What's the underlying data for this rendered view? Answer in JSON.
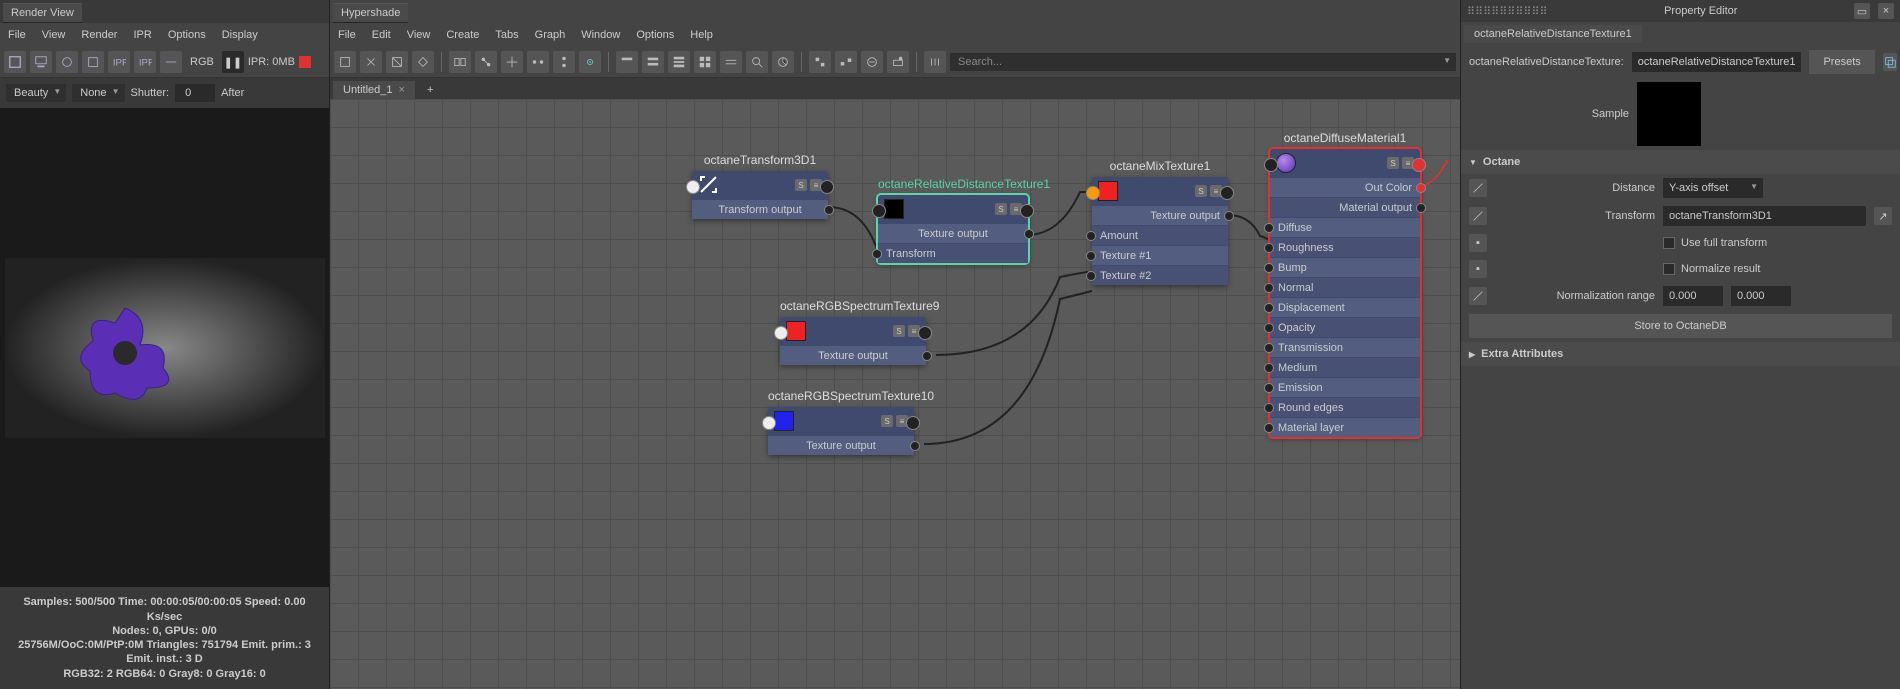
{
  "left": {
    "title": "Render View",
    "menu": [
      "File",
      "View",
      "Render",
      "IPR",
      "Options",
      "Display"
    ],
    "tool_labels": [
      "RGB",
      "IPR: 0MB"
    ],
    "opts": {
      "beauty": "Beauty",
      "none": "None",
      "shutter_lbl": "Shutter:",
      "shutter": "0",
      "after": "After"
    },
    "stats": {
      "l1": "Samples: 500/500 Time: 00:00:05/00:00:05 Speed: 0.00 Ks/sec",
      "l2": "Nodes: 0, GPUs: 0/0",
      "l3": "25756M/OoC:0M/PtP:0M Triangles: 751794 Emit. prim.: 3 Emit. inst.: 3 D",
      "l4": "RGB32: 2 RGB64: 0 Gray8: 0 Gray16: 0"
    }
  },
  "hs": {
    "title": "Hypershade",
    "menu": [
      "File",
      "Edit",
      "View",
      "Create",
      "Tabs",
      "Graph",
      "Window",
      "Options",
      "Help"
    ],
    "search_ph": "Search...",
    "tab": "Untitled_1",
    "nodes": {
      "transform": {
        "title": "octaneTransform3D1",
        "out": "Transform output"
      },
      "rel": {
        "title": "octaneRelativeDistanceTexture1",
        "out": "Texture output",
        "in": "Transform"
      },
      "rgb9": {
        "title": "octaneRGBSpectrumTexture9",
        "out": "Texture output"
      },
      "rgb10": {
        "title": "octaneRGBSpectrumTexture10",
        "out": "Texture output"
      },
      "mix": {
        "title": "octaneMixTexture1",
        "out": "Texture output",
        "rows": [
          "Amount",
          "Texture #1",
          "Texture #2"
        ]
      },
      "diff": {
        "title": "octaneDiffuseMaterial1",
        "out1": "Out Color",
        "out2": "Material output",
        "rows": [
          "Diffuse",
          "Roughness",
          "Bump",
          "Normal",
          "Displacement",
          "Opacity",
          "Transmission",
          "Medium",
          "Emission",
          "Round edges",
          "Material layer"
        ]
      }
    }
  },
  "pe": {
    "title": "Property Editor",
    "tab": "octaneRelativeDistanceTexture1",
    "type_lbl": "octaneRelativeDistanceTexture:",
    "type_val": "octaneRelativeDistanceTexture1",
    "presets": "Presets",
    "sample": "Sample",
    "section": "Octane",
    "distance_lbl": "Distance",
    "distance_val": "Y-axis offset",
    "transform_lbl": "Transform",
    "transform_val": "octaneTransform3D1",
    "full": "Use full transform",
    "norm": "Normalize result",
    "range_lbl": "Normalization range",
    "r1": "0.000",
    "r2": "0.000",
    "store": "Store to OctaneDB",
    "extra": "Extra Attributes"
  }
}
